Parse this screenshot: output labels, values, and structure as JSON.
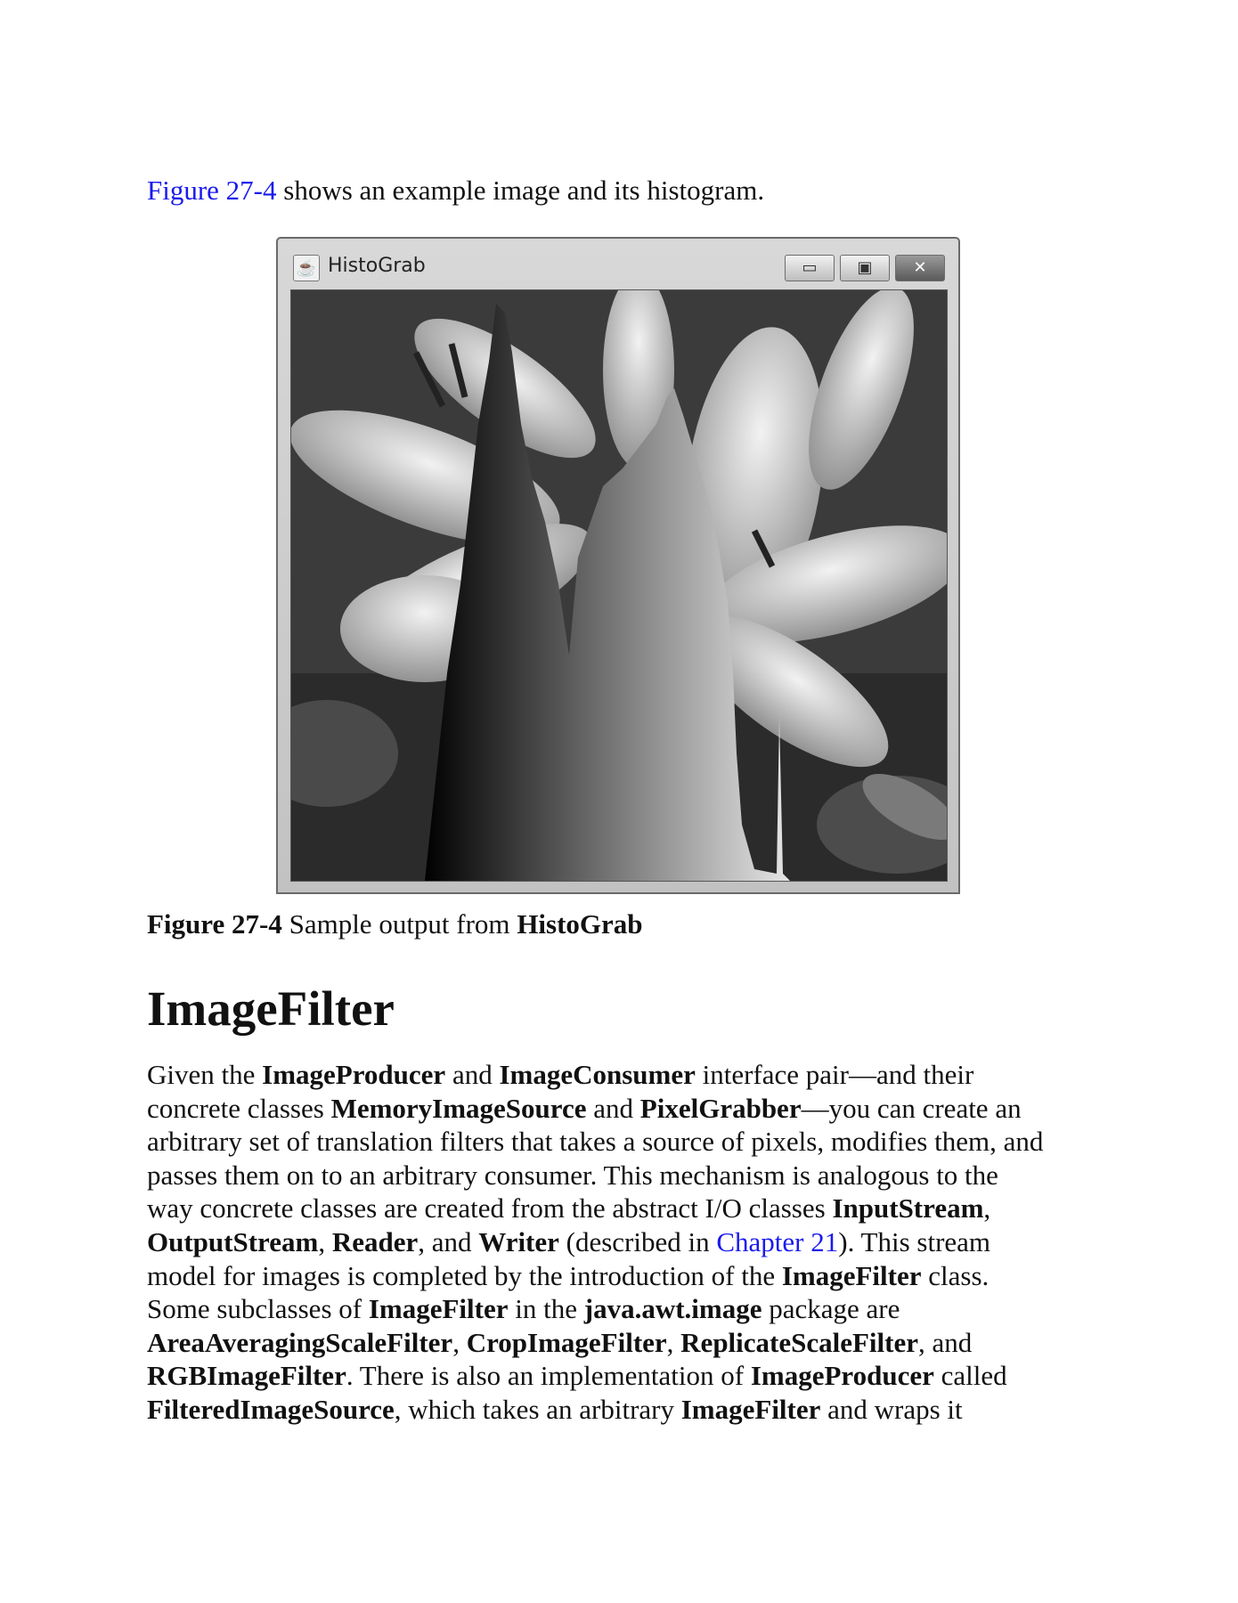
{
  "intro": {
    "link": "Figure 27-4",
    "rest": " shows an example image and its histogram."
  },
  "window": {
    "title": "HistoGrab",
    "icon": "java-cup-icon",
    "controls": {
      "minimize": "▭",
      "maximize": "▣",
      "close": "✕"
    }
  },
  "caption": {
    "label": "Figure 27-4",
    "text": " Sample output from ",
    "name": "HistoGrab"
  },
  "heading": "ImageFilter",
  "body": {
    "l1": [
      "Given the ",
      "ImageProducer",
      " and ",
      "ImageConsumer",
      " interface pair—and their"
    ],
    "l2": [
      "concrete classes ",
      "MemoryImageSource",
      " and ",
      "PixelGrabber",
      "—you can create an"
    ],
    "l3": [
      "arbitrary set of translation filters that takes a source of pixels, modifies them, and"
    ],
    "l4": [
      "passes them on to an arbitrary consumer. This mechanism is analogous to the"
    ],
    "l5": [
      "way concrete classes are created from the abstract I/O classes ",
      "InputStream",
      ","
    ],
    "l6": [
      "OutputStream",
      ", ",
      "Reader",
      ", and ",
      "Writer",
      " (described in ",
      "Chapter 21",
      "). This stream"
    ],
    "l7": [
      "model for images is completed by the introduction of the ",
      "ImageFilter",
      " class."
    ],
    "l8": [
      "Some subclasses of ",
      "ImageFilter",
      " in the ",
      "java.awt.image",
      " package are"
    ],
    "l9": [
      "AreaAveragingScaleFilter",
      ", ",
      "CropImageFilter",
      ", ",
      "ReplicateScaleFilter",
      ", and"
    ],
    "l10": [
      "RGBImageFilter",
      ". There is also an implementation of ",
      "ImageProducer",
      " called"
    ],
    "l11": [
      "FilteredImageSource",
      ", which takes an arbitrary ",
      "ImageFilter",
      " and wraps it"
    ]
  }
}
